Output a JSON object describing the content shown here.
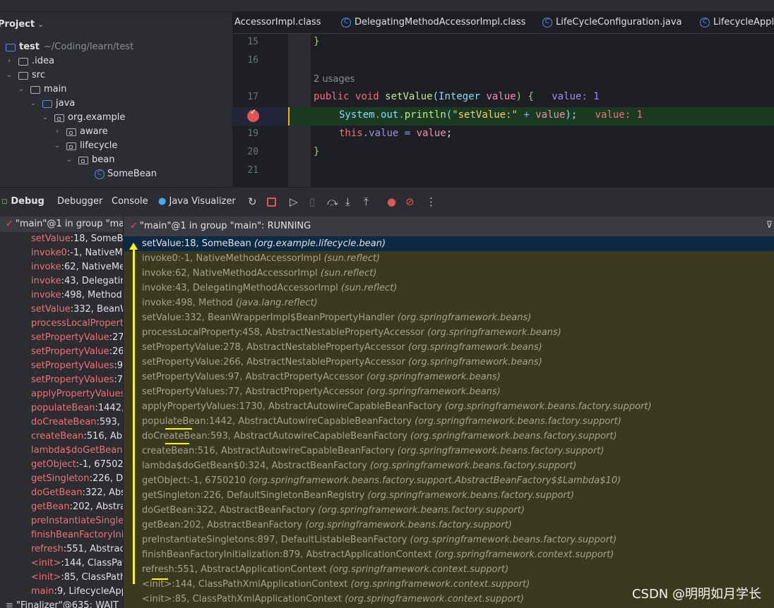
{
  "project": {
    "title": "Project",
    "root": {
      "name": "test",
      "path": "~/Coding/learn/test"
    },
    "items": [
      {
        "label": ".idea",
        "expanded": false
      },
      {
        "label": "src",
        "expanded": true
      },
      {
        "label": "main",
        "expanded": true
      },
      {
        "label": "java",
        "expanded": true
      },
      {
        "label": "org.example",
        "expanded": true
      },
      {
        "label": "aware",
        "expanded": false
      },
      {
        "label": "lifecycle",
        "expanded": true
      },
      {
        "label": "bean",
        "expanded": true
      },
      {
        "label": "SomeBean"
      }
    ]
  },
  "editor": {
    "tabs": [
      {
        "label": "AccessorImpl.class"
      },
      {
        "label": "DelegatingMethodAccessorImpl.class"
      },
      {
        "label": "LifeCycleConfiguration.java"
      },
      {
        "label": "LifecycleAppli"
      }
    ],
    "lines": {
      "l15": "15",
      "l16": "16",
      "l17": "17",
      "l19": "19",
      "l20": "20",
      "l21": "21"
    },
    "usages": "2 usages",
    "code": {
      "brace_close": "}",
      "public": "public",
      "void": "void",
      "setValue": "setValue",
      "paren_open": "(",
      "Integer": "Integer",
      "value": "value",
      "paren_rest": ") {",
      "hint17": "value: 1",
      "System": "System",
      "dot": ".",
      "out": "out",
      "println": "println",
      "str": "\"setValue:\"",
      "plus": "+",
      "tail18": ");",
      "hint18": "value: 1",
      "this": "this",
      "eq": "=",
      "semi": ";"
    }
  },
  "debug": {
    "title": "Debug",
    "tabs": [
      "Debugger",
      "Console",
      "Java Visualizer"
    ],
    "thread": {
      "left": "\"main\"@1 in group \"main\"",
      "right": "\"main\"@1 in group \"main\": RUNNING"
    },
    "other_thread": "\"Finalizer\"@635: WAIT",
    "frames": [
      {
        "method": "setValue",
        "rest": ":18, SomeBean",
        "pkg": "(org.example.lifecycle.bean)"
      },
      {
        "method": "invoke0",
        "rest": ":-1, NativeMethodAccessorImpl",
        "pkg": "(sun.reflect)"
      },
      {
        "method": "invoke",
        "rest": ":62, NativeMethodAccessorImpl",
        "pkg": "(sun.reflect)"
      },
      {
        "method": "invoke",
        "rest": ":43, DelegatingMethodAccessorImpl",
        "pkg": "(sun.reflect)"
      },
      {
        "method": "invoke",
        "rest": ":498, Method",
        "pkg": "(java.lang.reflect)"
      },
      {
        "method": "setValue",
        "rest": ":332, BeanWrapperImpl$BeanPropertyHandler",
        "pkg": "(org.springframework.beans)"
      },
      {
        "method": "processLocalProperty",
        "rest": ":458, AbstractNestablePropertyAccessor",
        "pkg": "(org.springframework.beans)"
      },
      {
        "method": "setPropertyValue",
        "rest": ":278, AbstractNestablePropertyAccessor",
        "pkg": "(org.springframework.beans)"
      },
      {
        "method": "setPropertyValue",
        "rest": ":266, AbstractNestablePropertyAccessor",
        "pkg": "(org.springframework.beans)"
      },
      {
        "method": "setPropertyValues",
        "rest": ":97, AbstractPropertyAccessor",
        "pkg": "(org.springframework.beans)"
      },
      {
        "method": "setPropertyValues",
        "rest": ":77, AbstractPropertyAccessor",
        "pkg": "(org.springframework.beans)"
      },
      {
        "method": "applyPropertyValues",
        "rest": ":1730, AbstractAutowireCapableBeanFactory",
        "pkg": "(org.springframework.beans.factory.support)"
      },
      {
        "method": "populateBean",
        "rest": ":1442, AbstractAutowireCapableBeanFactory",
        "pkg": "(org.springframework.beans.factory.support)"
      },
      {
        "method": "doCreateBean",
        "rest": ":593, AbstractAutowireCapableBeanFactory",
        "pkg": "(org.springframework.beans.factory.support)"
      },
      {
        "method": "createBean",
        "rest": ":516, AbstractAutowireCapableBeanFactory",
        "pkg": "(org.springframework.beans.factory.support)"
      },
      {
        "method": "lambda$doGetBean$0",
        "rest": ":324, AbstractBeanFactory",
        "pkg": "(org.springframework.beans.factory.support)"
      },
      {
        "method": "getObject",
        "rest": ":-1, 6750210",
        "pkg": "(org.springframework.beans.factory.support.AbstractBeanFactory$$Lambda$10)"
      },
      {
        "method": "getSingleton",
        "rest": ":226, DefaultSingletonBeanRegistry",
        "pkg": "(org.springframework.beans.factory.support)"
      },
      {
        "method": "doGetBean",
        "rest": ":322, AbstractBeanFactory",
        "pkg": "(org.springframework.beans.factory.support)"
      },
      {
        "method": "getBean",
        "rest": ":202, AbstractBeanFactory",
        "pkg": "(org.springframework.beans.factory.support)"
      },
      {
        "method": "preInstantiateSingletons",
        "rest": ":897, DefaultListableBeanFactory",
        "pkg": "(org.springframework.beans.factory.support)"
      },
      {
        "method": "finishBeanFactoryInitialization",
        "rest": ":879, AbstractApplicationContext",
        "pkg": "(org.springframework.context.support)"
      },
      {
        "method": "refresh",
        "rest": ":551, AbstractApplicationContext",
        "pkg": "(org.springframework.context.support)"
      },
      {
        "method": "<init>",
        "rest": ":144, ClassPathXmlApplicationContext",
        "pkg": "(org.springframework.context.support)"
      },
      {
        "method": "<init>",
        "rest": ":85, ClassPathXmlApplicationContext",
        "pkg": "(org.springframework.context.support)"
      },
      {
        "method": "main",
        "rest": ":9, LifecycleAppl",
        "pkg": ""
      }
    ]
  },
  "watermark": "CSDN @明明如月学长",
  "colors": {
    "frames_bg": "#3b3a1f",
    "selected": "#0d2a44",
    "method": "#f07178",
    "annotation": "#ffff00"
  }
}
